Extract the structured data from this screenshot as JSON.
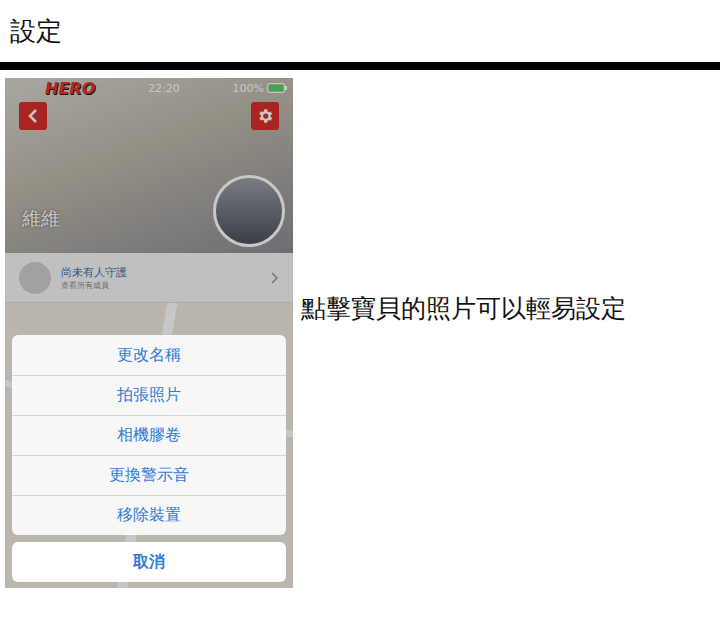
{
  "page": {
    "title": "設定",
    "caption": "點擊寶貝的照片可以輕易設定"
  },
  "status_bar": {
    "carrier": "HERO",
    "time": "22:20",
    "battery": "100%"
  },
  "profile": {
    "name": "維維"
  },
  "guardian": {
    "title": "尚未有人守護",
    "subtitle": "查看所有成員"
  },
  "action_sheet": {
    "options": [
      "更改名稱",
      "拍張照片",
      "相機膠卷",
      "更換警示音",
      "移除裝置"
    ],
    "cancel": "取消"
  }
}
